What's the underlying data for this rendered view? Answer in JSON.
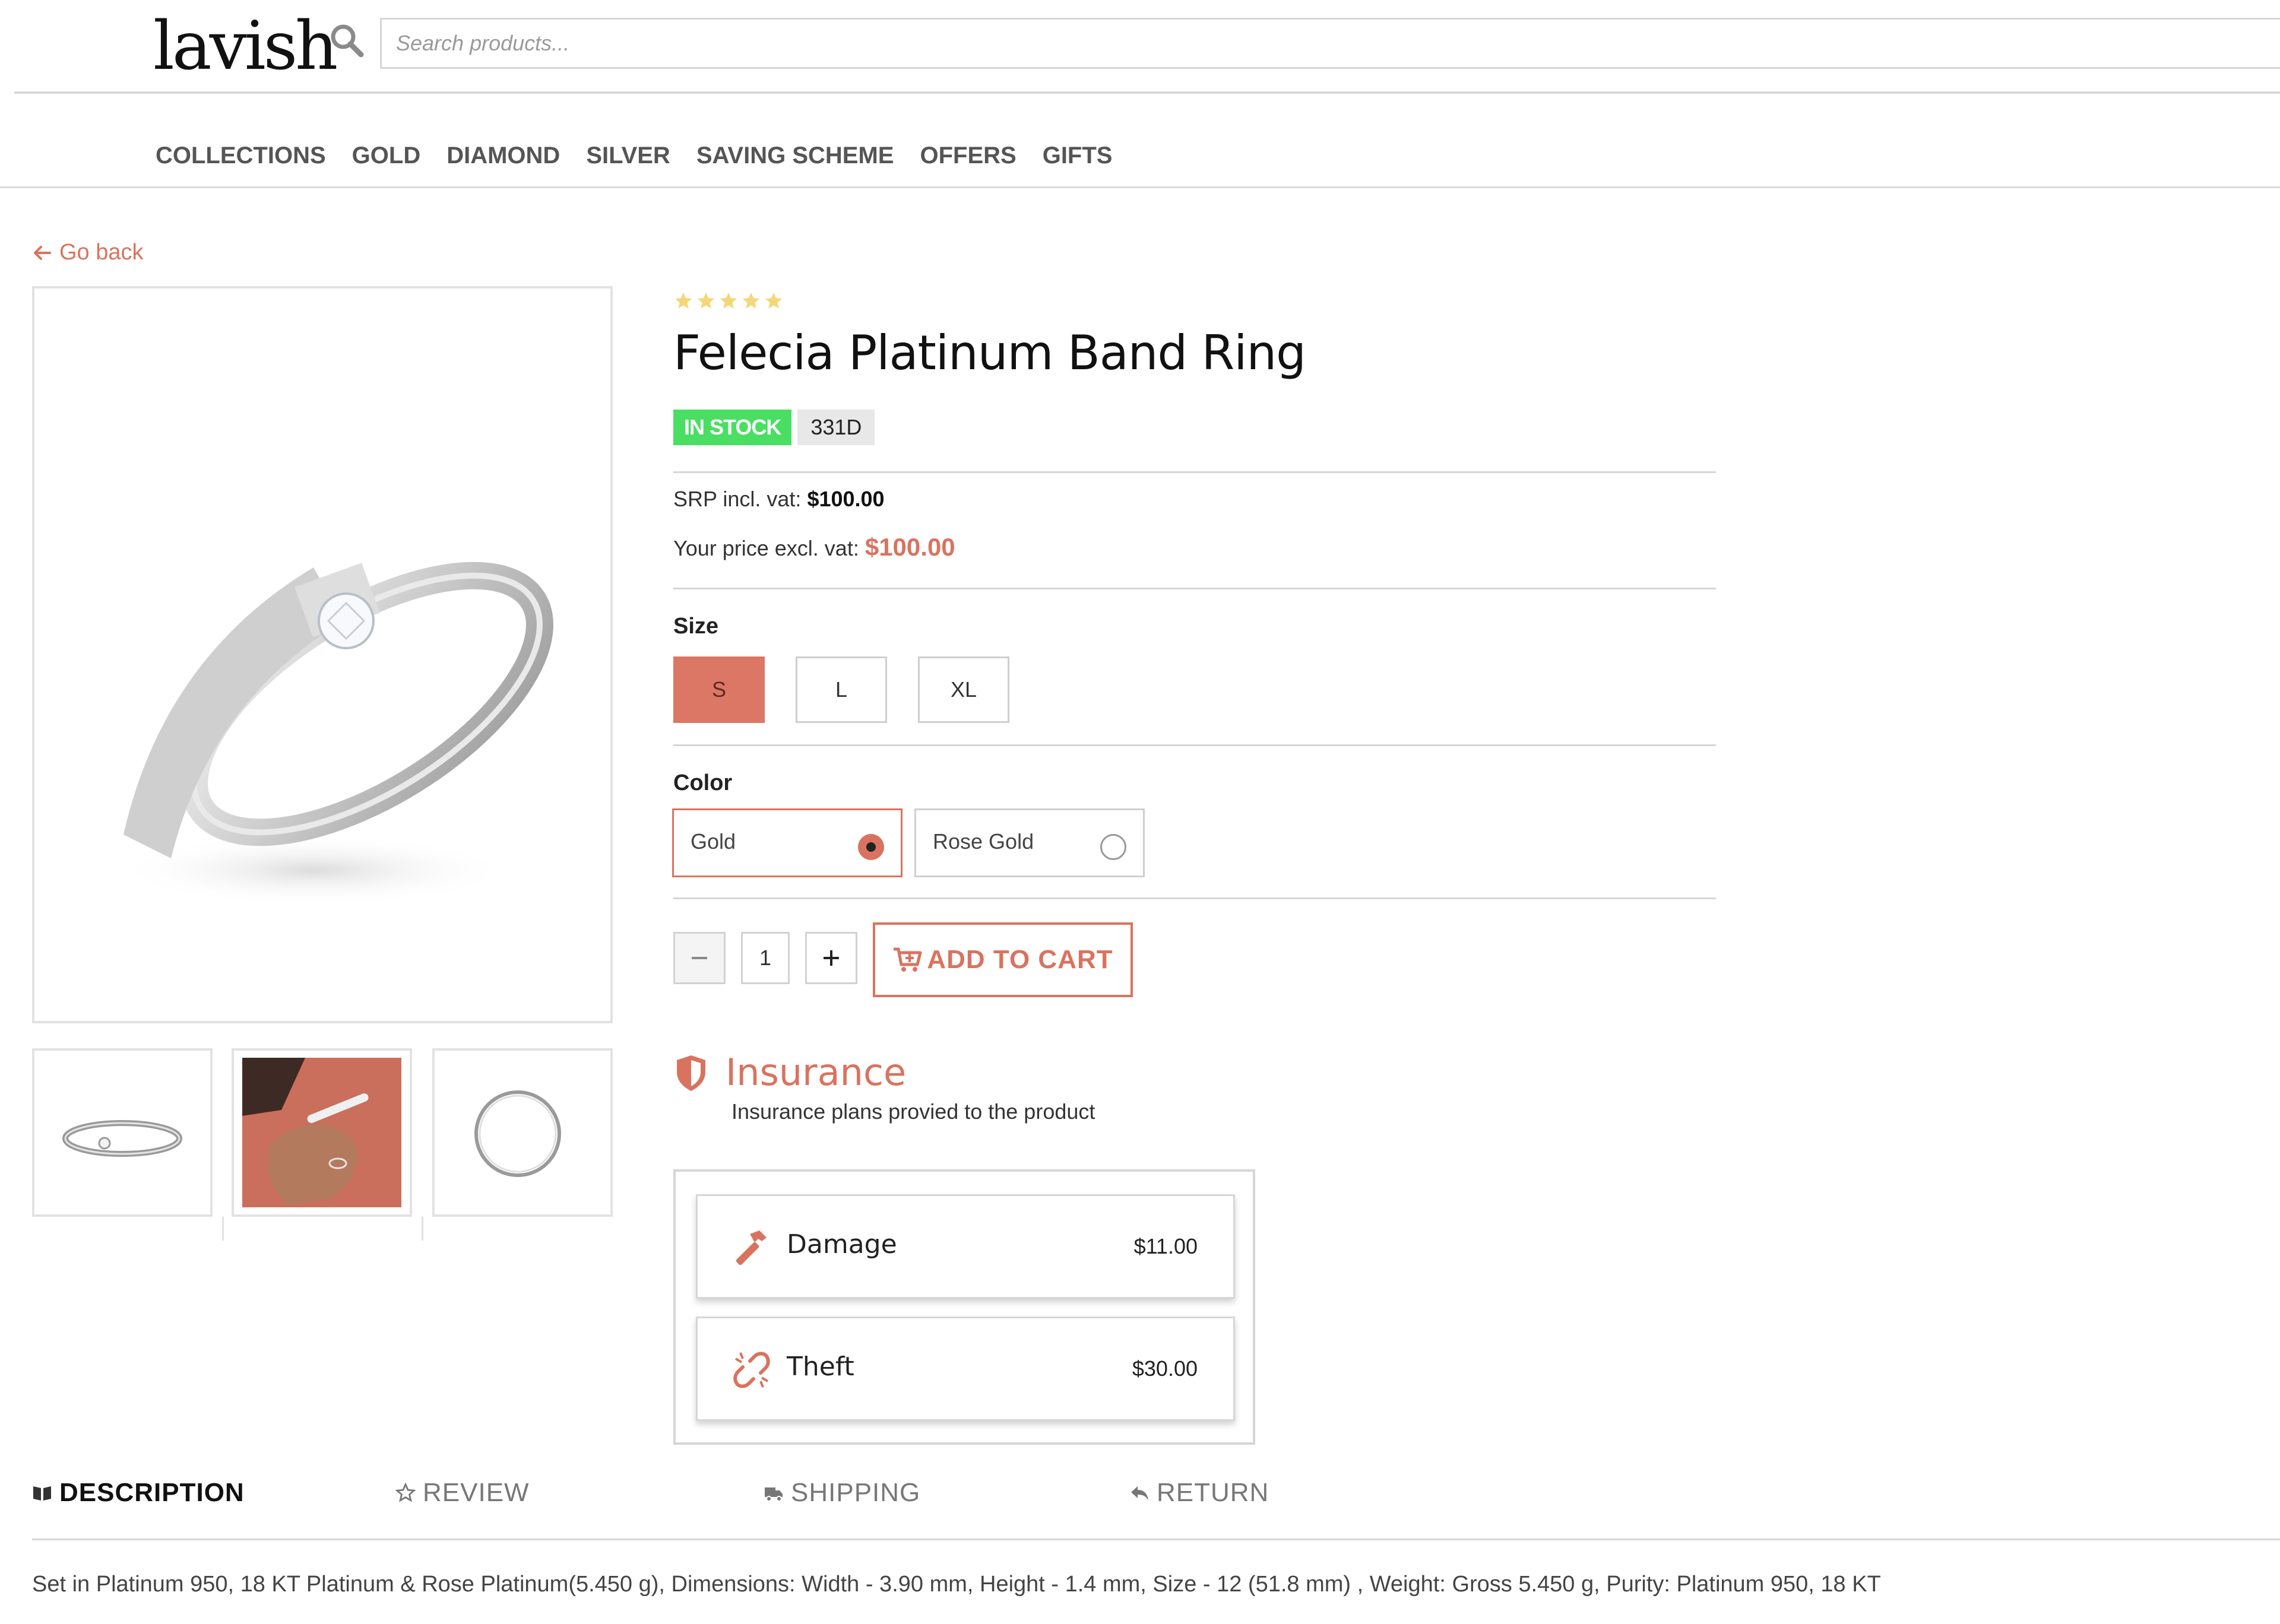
{
  "header": {
    "logo": "lavish",
    "search_placeholder": "Search products..."
  },
  "nav": {
    "items": [
      {
        "label": "COLLECTIONS"
      },
      {
        "label": "GOLD"
      },
      {
        "label": "DIAMOND"
      },
      {
        "label": "SILVER"
      },
      {
        "label": "SAVING SCHEME"
      },
      {
        "label": "OFFERS"
      },
      {
        "label": "GIFTS"
      }
    ]
  },
  "go_back": "Go back",
  "product": {
    "rating_stars": 5,
    "title": "Felecia Platinum Band Ring",
    "stock_badge": "IN STOCK",
    "sku_badge": "331D",
    "srp_label": "SRP incl. vat:",
    "srp_value": "$100.00",
    "price_label": "Your price excl. vat:",
    "price_value": "$100.00",
    "size_label": "Size",
    "sizes": [
      {
        "label": "S",
        "selected": true
      },
      {
        "label": "L",
        "selected": false
      },
      {
        "label": "XL",
        "selected": false
      }
    ],
    "color_label": "Color",
    "colors": [
      {
        "label": "Gold",
        "selected": true
      },
      {
        "label": "Rose Gold",
        "selected": false
      }
    ],
    "quantity": "1",
    "add_to_cart": "ADD TO CART"
  },
  "insurance": {
    "title": "Insurance",
    "description": "Insurance plans provied to the product",
    "plans": [
      {
        "label": "Damage",
        "price": "$11.00",
        "icon": "hammer-icon"
      },
      {
        "label": "Theft",
        "price": "$30.00",
        "icon": "broken-link-icon"
      }
    ]
  },
  "tabs": [
    {
      "label": "DESCRIPTION",
      "icon": "book-icon",
      "active": true
    },
    {
      "label": "REVIEW",
      "icon": "star-outline-icon",
      "active": false
    },
    {
      "label": "SHIPPING",
      "icon": "truck-icon",
      "active": false
    },
    {
      "label": "RETURN",
      "icon": "reply-icon",
      "active": false
    }
  ],
  "description_text": "Set in Platinum 950, 18 KT Platinum & Rose Platinum(5.450 g), Dimensions: Width - 3.90 mm, Height - 1.4 mm, Size - 12 (51.8 mm) , Weight: Gross 5.450 g, Purity: Platinum 950, 18 KT",
  "colors": {
    "accent": "#d9735f",
    "in_stock": "#4ade63",
    "star": "#f5d77a"
  }
}
